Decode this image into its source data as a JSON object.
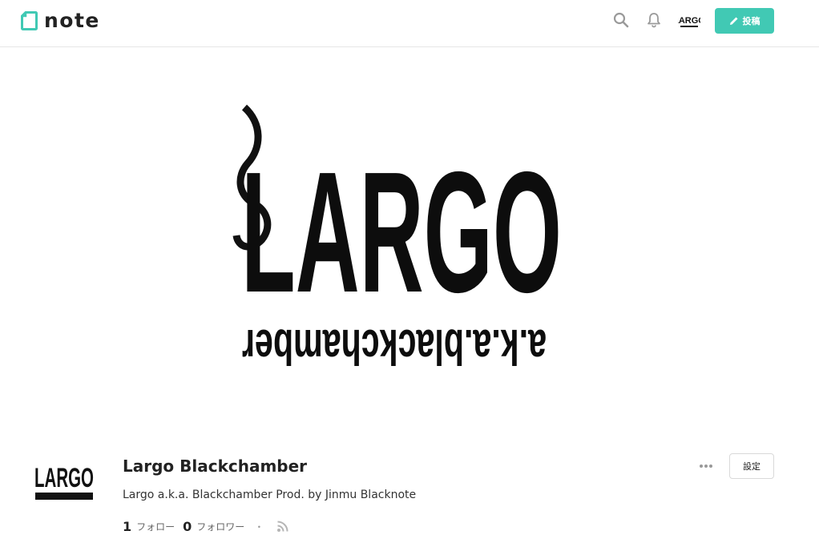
{
  "header": {
    "logo_text": "note",
    "post_label": "投稿",
    "avatar_text": "LARGO",
    "icons": [
      "note-logo-icon",
      "search-icon",
      "bell-icon",
      "pencil-icon"
    ],
    "accent_color": "#41c9b4"
  },
  "banner": {
    "logo_main": "LARGO",
    "logo_sub": "a.k.a.blackchamber"
  },
  "profile": {
    "avatar_text": "LARGO",
    "name": "Largo Blackchamber",
    "bio": "Largo a.k.a. Blackchamber Prod. by Jinmu Blacknote",
    "follow_count": "1",
    "follow_label": "フォロー",
    "follower_count": "0",
    "follower_label": "フォロワー",
    "separator": "・",
    "settings_label": "設定"
  }
}
